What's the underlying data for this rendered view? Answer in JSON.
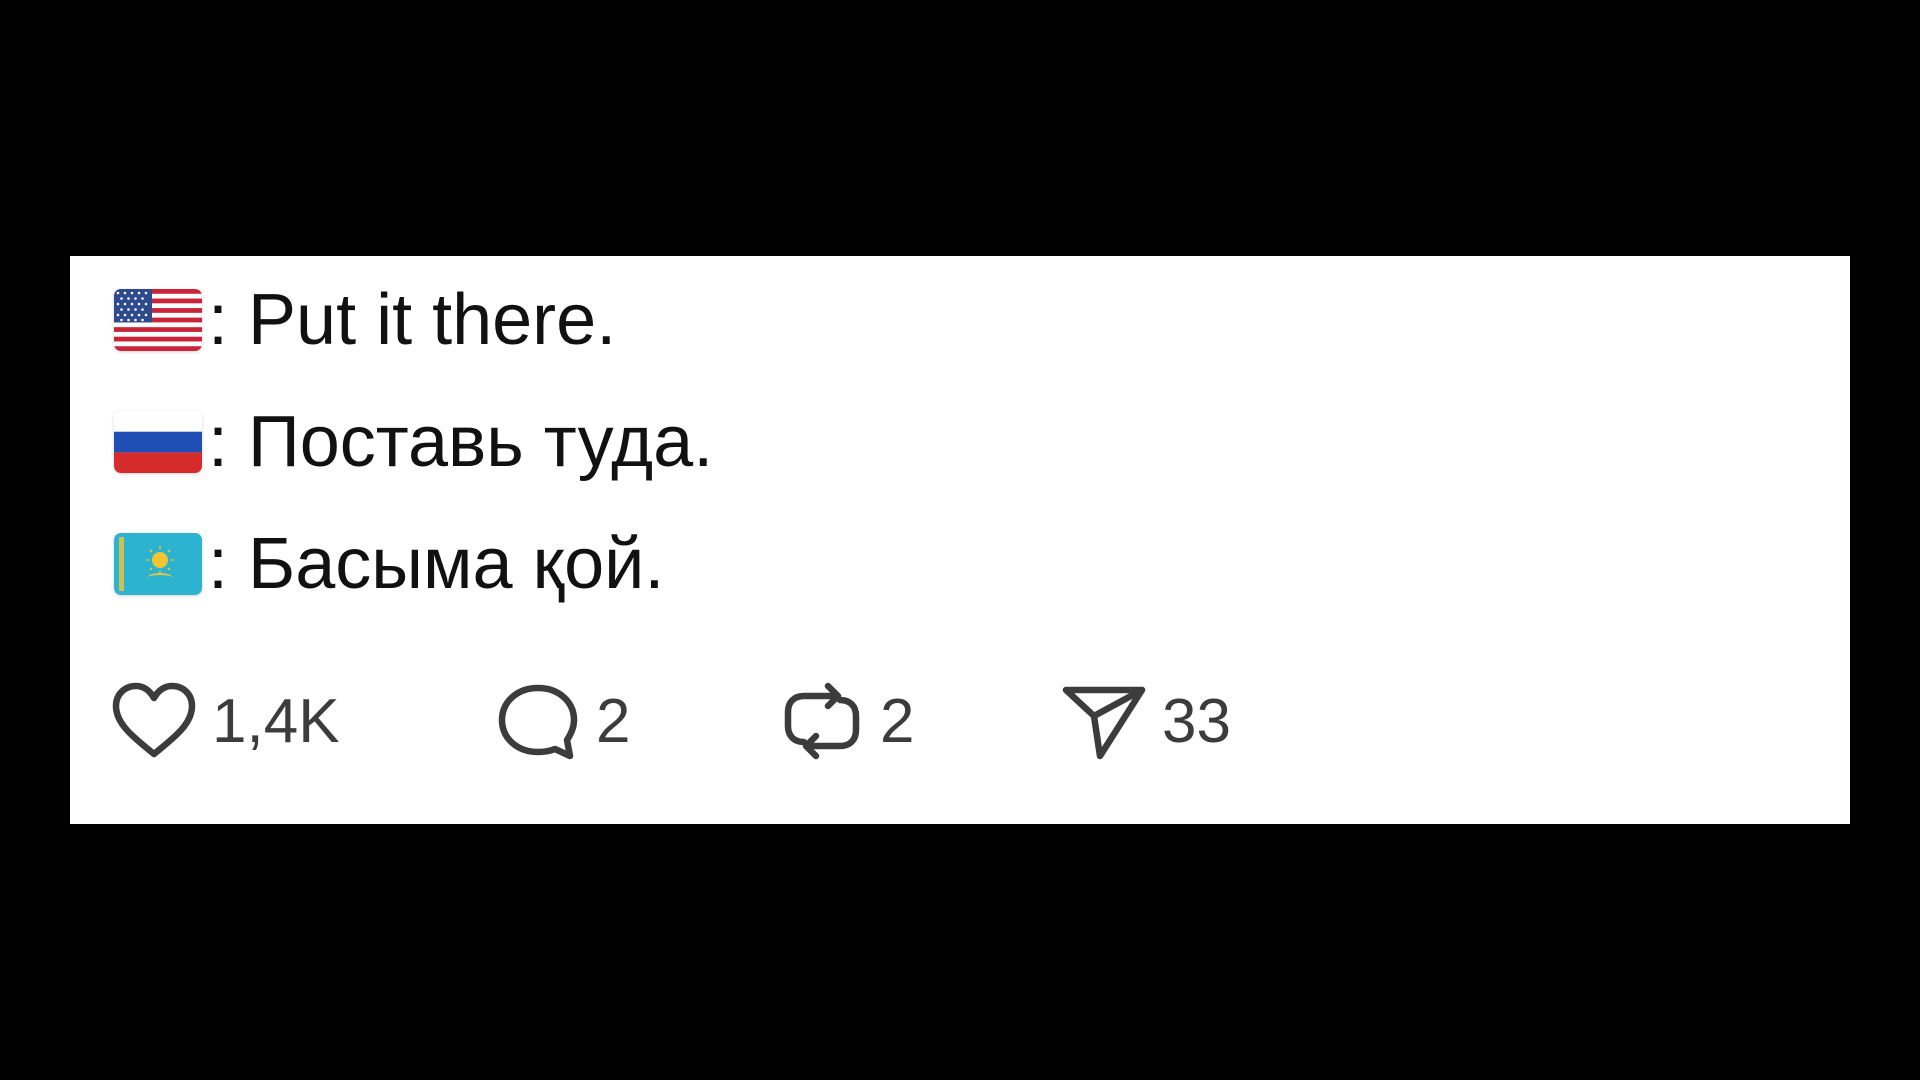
{
  "post": {
    "lines": [
      {
        "flag": "us-flag-icon",
        "text": ": Put it there."
      },
      {
        "flag": "ru-flag-icon",
        "text": ": Поставь туда."
      },
      {
        "flag": "kz-flag-icon",
        "text": ": Басыма қой."
      }
    ]
  },
  "actions": {
    "like": {
      "icon": "heart-icon",
      "count": "1,4K"
    },
    "comment": {
      "icon": "comment-bubble-icon",
      "count": "2"
    },
    "repost": {
      "icon": "repost-icon",
      "count": "2"
    },
    "share": {
      "icon": "send-icon",
      "count": "33"
    }
  },
  "colors": {
    "background": "#000000",
    "card": "#ffffff",
    "text": "#111111",
    "icon": "#3c3c3c"
  }
}
